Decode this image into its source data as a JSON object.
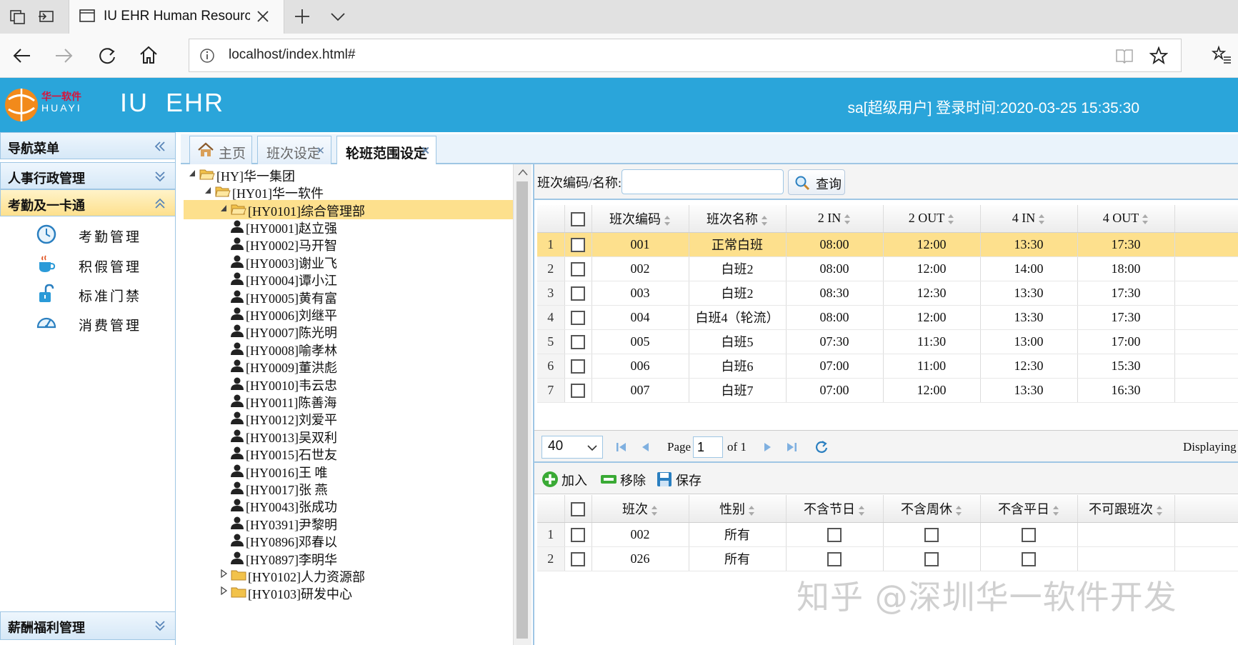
{
  "browser": {
    "tab_title": "IU EHR Human Resourc",
    "url": "localhost/index.html#"
  },
  "app": {
    "logo_text_cn": "华一软件",
    "logo_text_en": "HUAYI",
    "name": "IU  EHR",
    "user_info": "sa[超级用户] 登录时间:2020-03-25 15:35:30",
    "header_color": "#2aa5da"
  },
  "nav": {
    "title": "导航菜单",
    "groups": [
      "人事行政管理",
      "考勤及一卡通",
      "薪酬福利管理"
    ],
    "items": [
      {
        "label": "考勤管理",
        "icon": "clock-icon"
      },
      {
        "label": "积假管理",
        "icon": "coffee-cup-icon"
      },
      {
        "label": "标准门禁",
        "icon": "padlock-icon"
      },
      {
        "label": "消费管理",
        "icon": "gauge-icon"
      }
    ]
  },
  "tabs": [
    {
      "label": "主页",
      "icon": "home-icon"
    },
    {
      "label": "班次设定"
    },
    {
      "label": "轮班范围设定",
      "selected": true
    }
  ],
  "tree": {
    "root": "[HY]华一集团",
    "company": "[HY01]华一软件",
    "dept_selected": "[HY0101]综合管理部",
    "employees": [
      "[HY0001]赵立强",
      "[HY0002]马开智",
      "[HY0003]谢业飞",
      "[HY0004]谭小江",
      "[HY0005]黄有富",
      "[HY0006]刘继平",
      "[HY0007]陈光明",
      "[HY0008]喻孝林",
      "[HY0009]董洪彪",
      "[HY0010]韦云忠",
      "[HY0011]陈善海",
      "[HY0012]刘爱平",
      "[HY0013]吴双利",
      "[HY0015]石世友",
      "[HY0016]王 唯",
      "[HY0017]张 燕",
      "[HY0043]张成功",
      "[HY0391]尹黎明",
      "[HY0896]邓春以",
      "[HY0897]李明华"
    ],
    "other_depts": [
      "[HY0102]人力资源部",
      "[HY0103]研发中心"
    ]
  },
  "search": {
    "label": "班次编码/名称:",
    "value": "",
    "button": "查询"
  },
  "shift_grid": {
    "columns": [
      "班次编码",
      "班次名称",
      "2 IN",
      "2 OUT",
      "4 IN",
      "4 OUT"
    ],
    "rows": [
      {
        "n": "1",
        "code": "001",
        "name": "正常白班",
        "in2": "08:00",
        "out2": "12:00",
        "in4": "13:30",
        "out4": "17:30"
      },
      {
        "n": "2",
        "code": "002",
        "name": "白班2",
        "in2": "08:00",
        "out2": "12:00",
        "in4": "14:00",
        "out4": "18:00"
      },
      {
        "n": "3",
        "code": "003",
        "name": "白班2",
        "in2": "08:30",
        "out2": "12:30",
        "in4": "13:30",
        "out4": "17:30"
      },
      {
        "n": "4",
        "code": "004",
        "name": "白班4（轮流）",
        "in2": "08:00",
        "out2": "12:00",
        "in4": "13:30",
        "out4": "17:30"
      },
      {
        "n": "5",
        "code": "005",
        "name": "白班5",
        "in2": "07:30",
        "out2": "11:30",
        "in4": "13:00",
        "out4": "17:00"
      },
      {
        "n": "6",
        "code": "006",
        "name": "白班6",
        "in2": "07:00",
        "out2": "11:00",
        "in4": "12:30",
        "out4": "15:30"
      },
      {
        "n": "7",
        "code": "007",
        "name": "白班7",
        "in2": "07:00",
        "out2": "12:00",
        "in4": "13:30",
        "out4": "16:30"
      }
    ]
  },
  "pager": {
    "page_size": "40",
    "page_label": "Page",
    "page": "1",
    "of": "of 1",
    "displaying": "Displaying"
  },
  "toolbar": {
    "add": "加入",
    "remove": "移除",
    "save": "保存"
  },
  "range_grid": {
    "columns": [
      "班次",
      "性别",
      "不含节日",
      "不含周休",
      "不含平日",
      "不可跟班次"
    ],
    "rows": [
      {
        "n": "1",
        "shift": "002",
        "gender": "所有"
      },
      {
        "n": "2",
        "shift": "026",
        "gender": "所有"
      }
    ]
  },
  "watermark": "知乎 @深圳华一软件开发"
}
